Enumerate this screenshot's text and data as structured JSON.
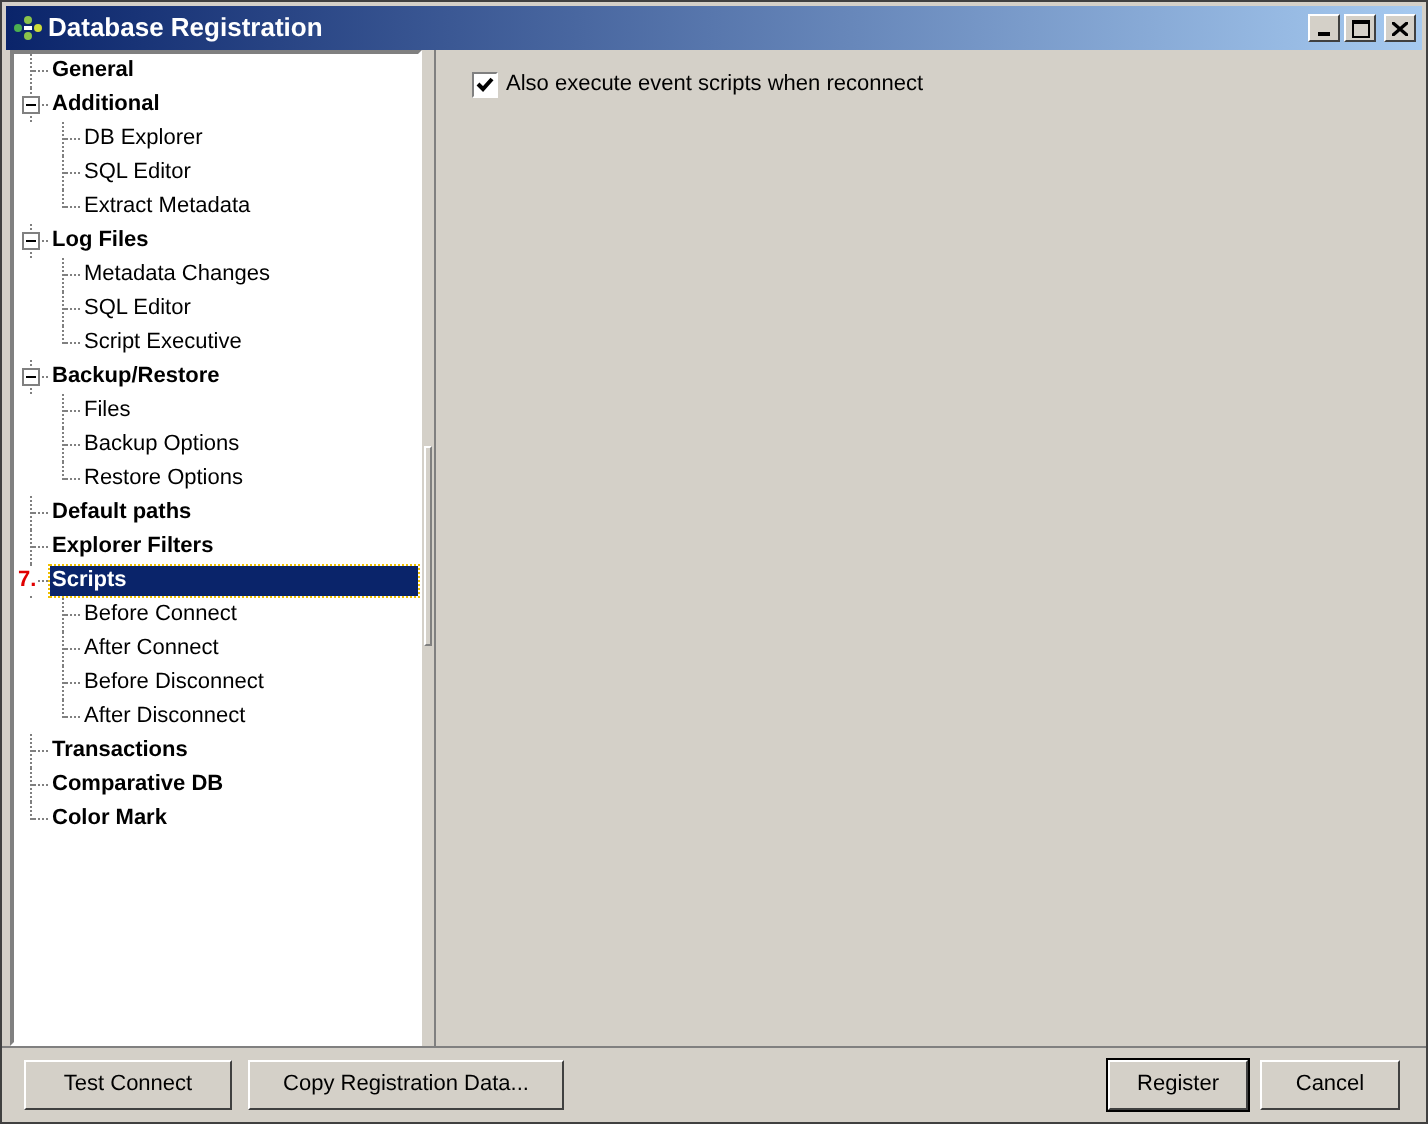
{
  "window": {
    "title": "Database Registration"
  },
  "tree": [
    {
      "label": "General",
      "selected": false
    },
    {
      "label": "Additional",
      "selected": false,
      "expanded": true,
      "children": [
        {
          "label": "DB Explorer",
          "selected": false
        },
        {
          "label": "SQL Editor",
          "selected": false
        },
        {
          "label": "Extract Metadata",
          "selected": false
        }
      ]
    },
    {
      "label": "Log Files",
      "selected": false,
      "expanded": true,
      "children": [
        {
          "label": "Metadata Changes",
          "selected": false
        },
        {
          "label": "SQL Editor",
          "selected": false
        },
        {
          "label": "Script Executive",
          "selected": false
        }
      ]
    },
    {
      "label": "Backup/Restore",
      "selected": false,
      "expanded": true,
      "children": [
        {
          "label": "Files",
          "selected": false
        },
        {
          "label": "Backup Options",
          "selected": false
        },
        {
          "label": "Restore Options",
          "selected": false
        }
      ]
    },
    {
      "label": "Default paths",
      "selected": false
    },
    {
      "label": "Explorer Filters",
      "selected": false
    },
    {
      "label": "Scripts",
      "selected": true,
      "annotation": "7.",
      "children": [
        {
          "label": "Before Connect",
          "selected": false
        },
        {
          "label": "After Connect",
          "selected": false
        },
        {
          "label": "Before Disconnect",
          "selected": false
        },
        {
          "label": "After Disconnect",
          "selected": false
        }
      ]
    },
    {
      "label": "Transactions",
      "selected": false
    },
    {
      "label": "Comparative DB",
      "selected": false
    },
    {
      "label": "Color Mark",
      "selected": false
    }
  ],
  "options": [
    {
      "label": "Also execute event scripts when reconnect",
      "checked": true
    }
  ],
  "buttons_left": [
    "Test Connect",
    "Copy Registration Data..."
  ],
  "buttons_right": [
    {
      "label": "Register",
      "default": true
    },
    {
      "label": "Cancel",
      "default": false
    }
  ]
}
